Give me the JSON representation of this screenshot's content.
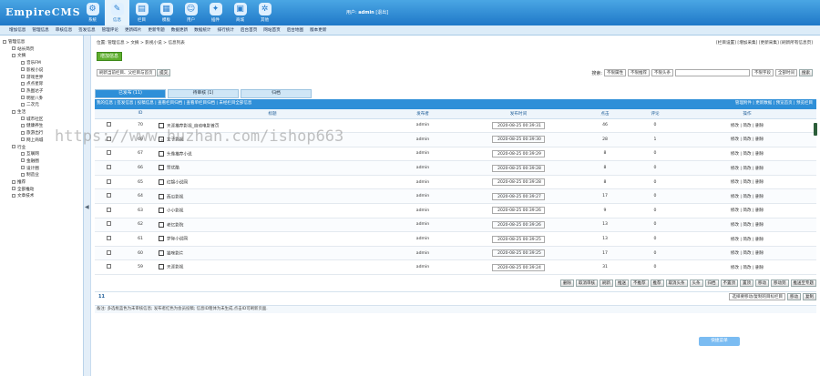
{
  "brand": {
    "logo": "EmpireCMS"
  },
  "nav": [
    "系统",
    "信息",
    "栏目",
    "模板",
    "用户",
    "插件",
    "商城",
    "其他"
  ],
  "user": {
    "prefix": "用户:",
    "name": "admin",
    "logout": "[退出]"
  },
  "subnav": [
    "增加信息",
    "管理信息",
    "审核信息",
    "签发信息",
    "管理评论",
    "更新碎片",
    "更新专题",
    "数据更新",
    "数据统计",
    "排行统计",
    "后台首页",
    "网站首页",
    "后台地图",
    "版本更新"
  ],
  "sidebar": [
    {
      "label": "管理信息",
      "level": 0
    },
    {
      "label": "站长简页",
      "level": 1
    },
    {
      "label": "文摘",
      "level": 1
    },
    {
      "label": "音乐FM",
      "level": 2
    },
    {
      "label": "影视小说",
      "level": 2
    },
    {
      "label": "游戏世界",
      "level": 2
    },
    {
      "label": "点点星际",
      "level": 2
    },
    {
      "label": "热图达子",
      "level": 2
    },
    {
      "label": "明星八卦",
      "level": 2
    },
    {
      "label": "二次元",
      "level": 2
    },
    {
      "label": "生活",
      "level": 1
    },
    {
      "label": "城市社区",
      "level": 2
    },
    {
      "label": "健康养生",
      "level": 2
    },
    {
      "label": "旅游出行",
      "level": 2
    },
    {
      "label": "网上商城",
      "level": 2
    },
    {
      "label": "行业",
      "level": 1
    },
    {
      "label": "互联网",
      "level": 2
    },
    {
      "label": "金融圈",
      "level": 2
    },
    {
      "label": "设计圈",
      "level": 2
    },
    {
      "label": "制造业",
      "level": 2
    },
    {
      "label": "推荐",
      "level": 1
    },
    {
      "label": "全部推动",
      "level": 1
    },
    {
      "label": "文章技术",
      "level": 1
    }
  ],
  "splitter": "◀",
  "breadcrumb": "位置: 管理信息 > 文摘 > 影视小说 > 信息列表",
  "toplinks": "[栏目设置] [增加采集] [更新采集] [刷新所有信息页]",
  "addButton": "增加信息",
  "filter": {
    "select": "刷新当前栏目、父栏目与首页",
    "button": "提交"
  },
  "search": {
    "label": "搜索:",
    "attr1": "不限属性",
    "attr2": "不限推荐",
    "attr3": "不限头条",
    "field": "不限字段",
    "type": "全部时间",
    "button": "搜索"
  },
  "tabs": [
    {
      "label": "已发布 (11)",
      "active": true
    },
    {
      "label": "待审核 (1)",
      "active": false
    },
    {
      "label": "归档",
      "active": false
    }
  ],
  "listlinks": {
    "left": "我的信息 | 签发信息 | 投稿信息 | 查看栏目归档 | 查看单栏目归档 | 未经栏目全部信息",
    "right": "管理附件 | 更新数据 | 预览首页 | 预览栏目"
  },
  "columns": {
    "id": "ID",
    "title": "标题",
    "publisher": "发布者",
    "date": "发布时间",
    "clicks": "点击",
    "comments": "评论",
    "ops": "操作"
  },
  "rows": [
    {
      "id": "70",
      "title": "天涯推荐影视_自动电影首页",
      "publisher": "admin",
      "date": "2020-08-25 00:39:31",
      "clicks": "46",
      "comments": "0"
    },
    {
      "id": "69",
      "title": "女子影视",
      "publisher": "admin",
      "date": "2020-08-25 00:39:30",
      "clicks": "28",
      "comments": "1"
    },
    {
      "id": "67",
      "title": "头像推荐小说",
      "publisher": "admin",
      "date": "2020-08-25 00:39:29",
      "clicks": "8",
      "comments": "0"
    },
    {
      "id": "66",
      "title": "赞优酷",
      "publisher": "admin",
      "date": "2020-08-25 00:39:28",
      "clicks": "8",
      "comments": "0"
    },
    {
      "id": "65",
      "title": "红锦小说网",
      "publisher": "admin",
      "date": "2020-08-25 00:39:28",
      "clicks": "8",
      "comments": "0"
    },
    {
      "id": "64",
      "title": "西瓜影视",
      "publisher": "admin",
      "date": "2020-08-25 00:39:27",
      "clicks": "17",
      "comments": "0"
    },
    {
      "id": "63",
      "title": "小小影视",
      "publisher": "admin",
      "date": "2020-08-25 00:39:26",
      "clicks": "9",
      "comments": "0"
    },
    {
      "id": "62",
      "title": "老忆影院",
      "publisher": "admin",
      "date": "2020-08-25 00:39:26",
      "clicks": "13",
      "comments": "0"
    },
    {
      "id": "61",
      "title": "梦际小说网",
      "publisher": "admin",
      "date": "2020-08-25 00:39:25",
      "clicks": "13",
      "comments": "0"
    },
    {
      "id": "60",
      "title": "猫咪影片",
      "publisher": "admin",
      "date": "2020-08-25 00:39:25",
      "clicks": "17",
      "comments": "0"
    },
    {
      "id": "59",
      "title": "天涯影视",
      "publisher": "admin",
      "date": "2020-08-25 00:39:24",
      "clicks": "31",
      "comments": "0"
    }
  ],
  "opLabels": {
    "edit": "修改",
    "simpleEdit": "简改",
    "delete": "删除"
  },
  "actions": [
    "删除",
    "取消审核",
    "刷新",
    "推送",
    "不推荐",
    "推荐",
    "取消头条",
    "头条",
    "归档",
    "不置顶",
    "置顶",
    "移动",
    "移动到",
    "推送至专题"
  ],
  "pager": {
    "count": "11",
    "selectTarget": "选择要移动/复制的目标栏目",
    "moveButton": "移动",
    "copyButton": "复制"
  },
  "note": "备注: 多选框蓝色为未审核信息; 发布者红色为会员投稿; 信息ID粗体为未生成,点击ID可刷新页面.",
  "floatButton": "快捷菜单",
  "watermark": "https://www.huzhan.com/ishop663"
}
